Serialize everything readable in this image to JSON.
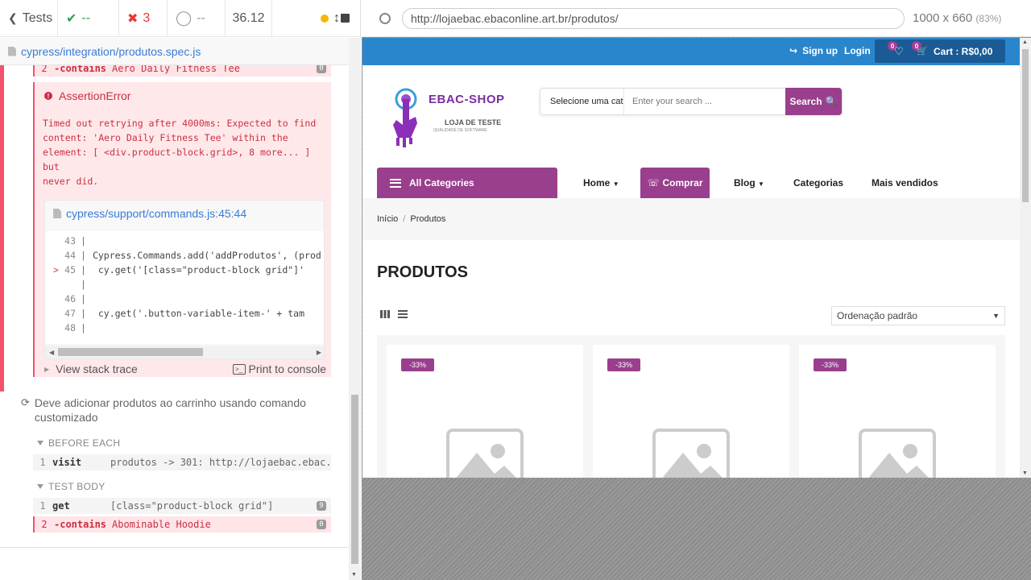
{
  "reporter": {
    "tests_label": "Tests",
    "passed": "--",
    "failed": "3",
    "pending": "--",
    "duration": "36.12",
    "spec_path": "cypress/integration/produtos.spec.js",
    "prev_cmd": {
      "num": "2",
      "name": "-contains",
      "arg": "Aero Daily Fitness Tee",
      "count": "0"
    },
    "error": {
      "title": "AssertionError",
      "message": "Timed out retrying after 4000ms: Expected to find\ncontent: 'Aero Daily Fitness Tee' within the\nelement: [ <div.product-block.grid>, 8 more... ] but\nnever did.",
      "file_link": "cypress/support/commands.js:45:44",
      "code_lines": [
        {
          "ln": "43",
          "code": ""
        },
        {
          "ln": "44",
          "code": "Cypress.Commands.add('addProdutos', (prod"
        },
        {
          "ln": "45",
          "code": "    cy.get('[class=\"product-block grid\"]'"
        },
        {
          "ln": "",
          "code": ""
        },
        {
          "ln": "46",
          "code": ""
        },
        {
          "ln": "47",
          "code": "    cy.get('.button-variable-item-' + tam"
        },
        {
          "ln": "48",
          "code": ""
        }
      ],
      "stack_label": "View stack trace",
      "print_label": "Print to console"
    },
    "test2": {
      "title": "Deve adicionar produtos ao carrinho usando comando customizado",
      "before_each": "BEFORE EACH",
      "visit": {
        "num": "1",
        "name": "visit",
        "arg": "produtos -> 301: http://lojaebac.ebac..."
      },
      "test_body": "TEST BODY",
      "get": {
        "num": "1",
        "name": "get",
        "arg": "[class=\"product-block grid\"]",
        "count": "9"
      },
      "contains": {
        "num": "2",
        "name": "-contains",
        "arg": "Abominable Hoodie",
        "count": "0"
      }
    }
  },
  "aut": {
    "url": "http://lojaebac.ebaconline.art.br/produtos/",
    "viewport": "1000 x 660",
    "zoom": "(83%)"
  },
  "site": {
    "signup": "Sign up",
    "login": "Login",
    "wishlist_count": "0",
    "cart_count": "0",
    "cart_label": "Cart : R$0,00",
    "brand": "EBAC-SHOP",
    "brand_sub": "LOJA DE TESTE",
    "brand_sub2": "QUALIDADE DE SOFTWARE",
    "search_category": "Selecione uma cat",
    "search_placeholder": "Enter your search ...",
    "search_button": "Search",
    "all_categories": "All Categories",
    "nav": {
      "home": "Home",
      "comprar": "Comprar",
      "blog": "Blog",
      "categorias": "Categorias",
      "mais": "Mais vendidos"
    },
    "breadcrumb": {
      "home": "Início",
      "sep": "/",
      "current": "Produtos"
    },
    "page_title": "PRODUTOS",
    "sort": "Ordenação padrão",
    "products": [
      {
        "sale": "-33%"
      },
      {
        "sale": "-33%"
      },
      {
        "sale": "-33%"
      }
    ],
    "colors": {
      "purple": "#993f8d",
      "topbar": "#2a86cc",
      "cart": "#1a5b96"
    }
  }
}
